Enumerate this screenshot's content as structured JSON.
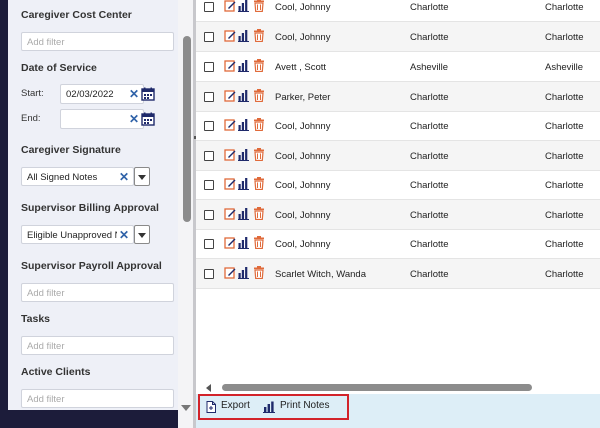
{
  "filters": {
    "caregiver_cost_center": {
      "title": "Caregiver Cost Center",
      "placeholder": "Add filter"
    },
    "date_of_service": {
      "title": "Date of Service",
      "start_label": "Start:",
      "start_value": "02/03/2022",
      "end_label": "End:",
      "end_value": ""
    },
    "caregiver_signature": {
      "title": "Caregiver Signature",
      "selected": "All Signed Notes"
    },
    "supervisor_billing_approval": {
      "title": "Supervisor Billing Approval",
      "selected": "Eligible Unapproved Nc"
    },
    "supervisor_payroll_approval": {
      "title": "Supervisor Payroll Approval",
      "placeholder": "Add filter"
    },
    "tasks": {
      "title": "Tasks",
      "placeholder": "Add filter"
    },
    "active_clients": {
      "title": "Active Clients",
      "placeholder": "Add filter"
    }
  },
  "rows": [
    {
      "name": "Cool, Johnny",
      "city1": "Charlotte",
      "city2": "Charlotte"
    },
    {
      "name": "Cool, Johnny",
      "city1": "Charlotte",
      "city2": "Charlotte"
    },
    {
      "name": "Avett , Scott",
      "city1": "Asheville",
      "city2": "Asheville"
    },
    {
      "name": "Parker, Peter",
      "city1": "Charlotte",
      "city2": "Charlotte"
    },
    {
      "name": "Cool, Johnny",
      "city1": "Charlotte",
      "city2": "Charlotte"
    },
    {
      "name": "Cool, Johnny",
      "city1": "Charlotte",
      "city2": "Charlotte"
    },
    {
      "name": "Cool, Johnny",
      "city1": "Charlotte",
      "city2": "Charlotte"
    },
    {
      "name": "Cool, Johnny",
      "city1": "Charlotte",
      "city2": "Charlotte"
    },
    {
      "name": "Cool, Johnny",
      "city1": "Charlotte",
      "city2": "Charlotte"
    },
    {
      "name": "Scarlet Witch, Wanda",
      "city1": "Charlotte",
      "city2": "Charlotte"
    }
  ],
  "footer": {
    "export_label": "Export",
    "print_notes_label": "Print Notes"
  },
  "colors": {
    "edit_icon": "#e06a3a",
    "chart_icon": "#1f2a6b",
    "trash_icon": "#e06a3a",
    "highlight_border": "#d2232a",
    "footer_bg": "#ddeef7"
  },
  "icons": {
    "edit": "edit-note-icon",
    "chart": "bar-chart-icon",
    "delete": "trash-icon",
    "calendar": "calendar-icon",
    "clear": "clear-x-icon",
    "export": "export-file-icon",
    "print": "print-notes-icon"
  }
}
